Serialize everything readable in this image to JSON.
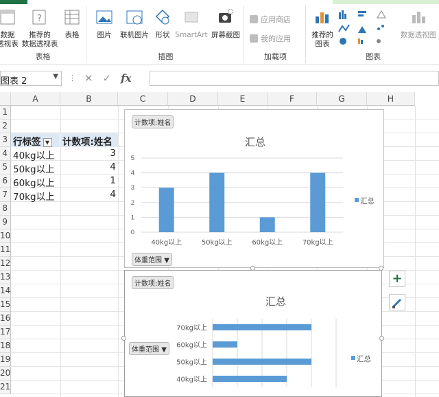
{
  "ribbon": {
    "groups": {
      "tables": {
        "label": "表格",
        "buttons": [
          "数据\n透视表",
          "推荐的\n数据透视表",
          "表格"
        ]
      },
      "illustrations": {
        "label": "插图",
        "buttons": [
          "图片",
          "联机图片",
          "形状",
          "SmartArt",
          "屏幕截图"
        ]
      },
      "addins": {
        "label": "加载项",
        "buttons": [
          "应用商店",
          "我的应用"
        ]
      },
      "charts": {
        "label": "图表",
        "buttons": [
          "推荐的\n图表",
          "数据透视图"
        ]
      }
    }
  },
  "formula_bar": {
    "name_box": "图表 2",
    "fx": "fx",
    "cancel": "✕",
    "confirm": "✓"
  },
  "columns": [
    "A",
    "B",
    "C",
    "D",
    "E",
    "F",
    "G",
    "H"
  ],
  "rows": [
    "1",
    "2",
    "3",
    "4",
    "5",
    "6",
    "7",
    "8",
    "9",
    "10",
    "11",
    "12",
    "13",
    "14",
    "15",
    "16",
    "17",
    "18",
    "19",
    "20",
    "21"
  ],
  "pivot": {
    "header_row_label": "行标签",
    "header_value_label": "计数项:姓名",
    "rows": [
      {
        "label": "40kg以上",
        "value": "3"
      },
      {
        "label": "50kg以上",
        "value": "4"
      },
      {
        "label": "60kg以上",
        "value": "1"
      },
      {
        "label": "70kg以上",
        "value": "4"
      }
    ]
  },
  "chart_data": [
    {
      "type": "bar",
      "orientation": "vertical",
      "title": "汇总",
      "value_field_button": "计数项:姓名",
      "axis_field_button": "体重范围",
      "categories": [
        "40kg以上",
        "50kg以上",
        "60kg以上",
        "70kg以上"
      ],
      "series": [
        {
          "name": "汇总",
          "values": [
            3,
            4,
            1,
            4
          ]
        }
      ],
      "ylim": [
        0,
        5
      ],
      "yticks": [
        "0",
        "1",
        "2",
        "3",
        "4",
        "5"
      ],
      "legend": "right",
      "grid": true,
      "color": "#5b9bd5"
    },
    {
      "type": "bar",
      "orientation": "horizontal",
      "title": "汇总",
      "value_field_button": "计数项:姓名",
      "axis_field_button": "体重范围",
      "categories": [
        "70kg以上",
        "60kg以上",
        "50kg以上",
        "40kg以上"
      ],
      "series": [
        {
          "name": "汇总",
          "values": [
            4,
            1,
            4,
            3
          ]
        }
      ],
      "xlim": [
        0,
        5
      ],
      "legend": "right",
      "grid": true,
      "color": "#5b9bd5"
    }
  ],
  "chart_side_buttons": {
    "add": "+",
    "style": "brush"
  }
}
